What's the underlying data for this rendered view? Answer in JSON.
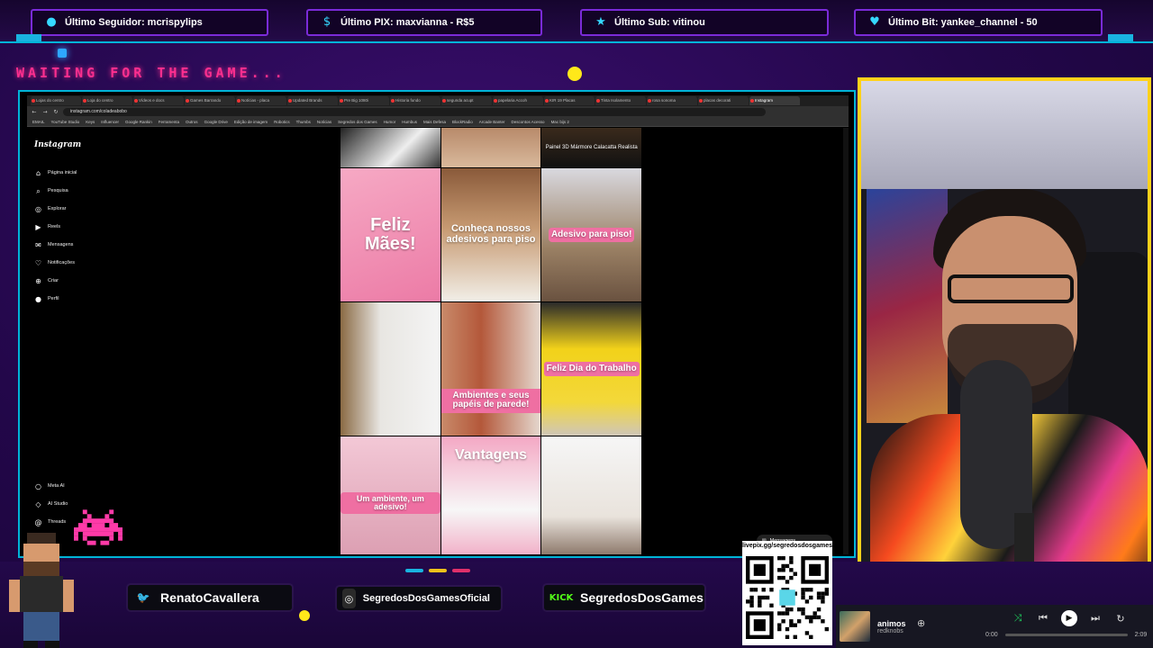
{
  "alerts": {
    "follower": "Último Seguidor: mcrispylips",
    "pix": "Último PIX: maxvianna - R$5",
    "sub": "Último Sub: vitinou",
    "bit": "Último Bit: yankee_channel - 50"
  },
  "waiting": "WAITING FOR THE GAME...",
  "browser": {
    "tabs": [
      "Lojas do centro",
      "Loja do centro",
      "Vídeos e docs",
      "Games Barrando",
      "Notícias - placa",
      "Updated Brands",
      "Pre Big 1080i",
      "Historia fundo",
      "segunda acupt",
      "papelaria Accoh",
      "KIR 19 Placas",
      "Tinta Isolamento",
      "rosa sonoma",
      "placas decorati",
      "Instagram"
    ],
    "url": "instagram.com/coladeabobo",
    "bookmarks": [
      "EMAIL",
      "YouTube Studio",
      "Keys",
      "Influencer",
      "Google Rankin",
      "Ferramenta",
      "Outros",
      "Google Drive",
      "Edição de imagem",
      "Robotics",
      "Thumbs",
      "Notícias",
      "Segredos dos Games",
      "Humor",
      "Humbus",
      "Mais Defesa",
      "BlockRadio",
      "Arcade Banter",
      "Descontos Acesso",
      "Mac bijs 2"
    ]
  },
  "instagram": {
    "logo": "Instagram",
    "nav": [
      {
        "icon": "⌂",
        "label": "Página inicial"
      },
      {
        "icon": "⌕",
        "label": "Pesquisa"
      },
      {
        "icon": "◎",
        "label": "Explorar"
      },
      {
        "icon": "▶",
        "label": "Reels"
      },
      {
        "icon": "✉",
        "label": "Mensagens"
      },
      {
        "icon": "♡",
        "label": "Notificações"
      },
      {
        "icon": "⊕",
        "label": "Criar"
      },
      {
        "icon": "●",
        "label": "Perfil"
      }
    ],
    "bottom_nav": [
      {
        "icon": "○",
        "label": "Meta AI"
      },
      {
        "icon": "◇",
        "label": "AI Studio"
      },
      {
        "icon": "@",
        "label": "Threads"
      }
    ],
    "posts": {
      "top": [
        "",
        "",
        "Painel 3D Mármore Calacatta Realista"
      ],
      "row1": [
        "Feliz Mães!",
        "Conheça nossos adesivos para piso",
        "Adesivo para piso!"
      ],
      "row2": [
        "",
        "Ambientes e seus papéis de parede!",
        "Feliz Dia do Trabalho"
      ],
      "row3": [
        "Um ambiente, um adesivo!",
        "Vantagens",
        ""
      ]
    },
    "messages_label": "Mensagens"
  },
  "socials": {
    "twitter": "RenatoCavallera",
    "instagram": "SegredosDosGamesOficial",
    "kick": "SegredosDosGames"
  },
  "qr_caption": "livepix.gg/segredosdosgames",
  "player": {
    "title": "animos",
    "artist": "redknobs",
    "elapsed": "0:00",
    "duration": "2:09",
    "progress": 0
  },
  "colors": {
    "accent_cyan": "#00b4d8",
    "accent_pink": "#ff2f8f",
    "cam_border": "#ffd21a",
    "purple_bg": "#23074a"
  }
}
